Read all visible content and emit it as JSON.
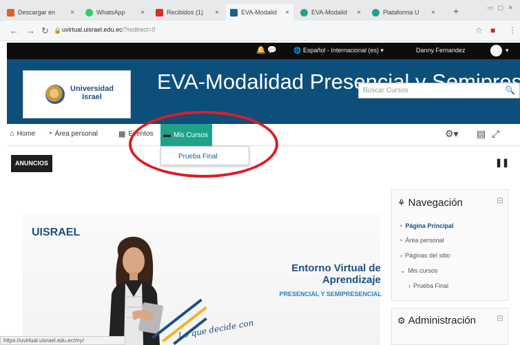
{
  "tabs": [
    {
      "label": "Descargar en",
      "color": "#e45b2c"
    },
    {
      "label": "WhatsApp",
      "color": "#25d366"
    },
    {
      "label": "Recibidos (1)",
      "color": "#d93025"
    },
    {
      "label": "EVA-Modalid",
      "color": "#1a5f91",
      "active": true
    },
    {
      "label": "EVA-Modalid",
      "color": "#1ea38a"
    },
    {
      "label": "Plataforma U",
      "color": "#1ea38a"
    }
  ],
  "address": {
    "host": "uvirtual.uisrael.edu.ec",
    "path": "/?redirect=0"
  },
  "topbar": {
    "language": "Español - Internacional (es) ▾",
    "user": "Danny Fernandez"
  },
  "banner": {
    "logo_line1": "Universidad",
    "logo_line2": "Israel",
    "site_title": "EVA-Modalidad Presencial y Semipres",
    "search_placeholder": "Buscar Cursos"
  },
  "menu": {
    "home": "Home",
    "area": "Área personal",
    "eventos": "Eventos",
    "mis_cursos": "Mis Cursos",
    "dropdown_item": "Prueba Final"
  },
  "anuncios": "ANUNCIOS",
  "promo": {
    "brand": "UISRAEL",
    "line1": "Entorno Virtual de",
    "line2": "Aprendizaje",
    "line3": "PRESENCIAL Y SEMIPRESENCIAL",
    "handwriting": "Lo que decide con"
  },
  "navegacion": {
    "title": "Navegación",
    "items": [
      "Página Principal",
      "Área personal",
      "Páginas del sitio",
      "Mis cursos",
      "Prueba Final"
    ]
  },
  "administracion": {
    "title": "Administración"
  },
  "status_tip": "https://uvirtual.uisrael.edu.ec/my/"
}
